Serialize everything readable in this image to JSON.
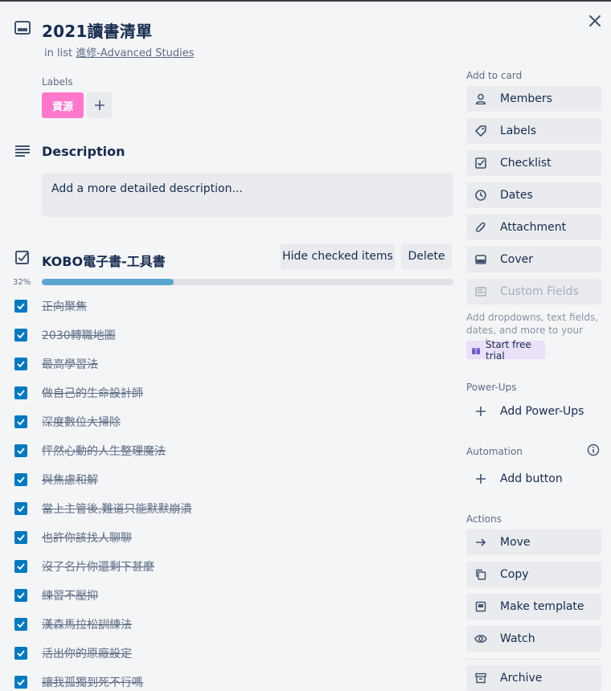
{
  "card": {
    "title": "2021讀書清單",
    "in_list_prefix": "in list",
    "list_name": "進修-Advanced Studies"
  },
  "labels": {
    "heading": "Labels",
    "items": [
      {
        "text": "資源",
        "color": "#ff78cb"
      }
    ]
  },
  "description": {
    "heading": "Description",
    "placeholder": "Add a more detailed description..."
  },
  "checklist": {
    "title": "KOBO電子書-工具書",
    "hide_button": "Hide checked items",
    "delete_button": "Delete",
    "percent_label": "32%",
    "progress": 0.32,
    "items": [
      "正向聚焦",
      "2030轉職地圖",
      "最高學習法",
      "做自己的生命設計師",
      "深度數位大掃除",
      "怦然心動的人生整理魔法",
      "與焦慮和解",
      "當上主管後,難道只能默默崩潰",
      "也許你該找人聊聊",
      "沒了名片你還剩下甚麼",
      "練習不壓抑",
      "漢森馬拉松訓練法",
      "活出你的原廠設定",
      "讓我孤獨到死不行嗎"
    ]
  },
  "sidebar": {
    "add_to_card": {
      "heading": "Add to card",
      "buttons": [
        "Members",
        "Labels",
        "Checklist",
        "Dates",
        "Attachment",
        "Cover",
        "Custom Fields"
      ]
    },
    "custom_fields_note": "Add dropdowns, text fields, dates, and more to your cards.",
    "trial_button": "Start free trial",
    "power_ups": {
      "heading": "Power-Ups",
      "add": "Add Power-Ups"
    },
    "automation": {
      "heading": "Automation",
      "add": "Add button"
    },
    "actions": {
      "heading": "Actions",
      "buttons": [
        "Move",
        "Copy",
        "Make template",
        "Watch",
        "Archive"
      ]
    }
  },
  "colors": {
    "accent": "#0079bf",
    "progress": "#5ba4cf",
    "label_pink": "#ff78cb",
    "trial_bg": "#eae0f7"
  }
}
